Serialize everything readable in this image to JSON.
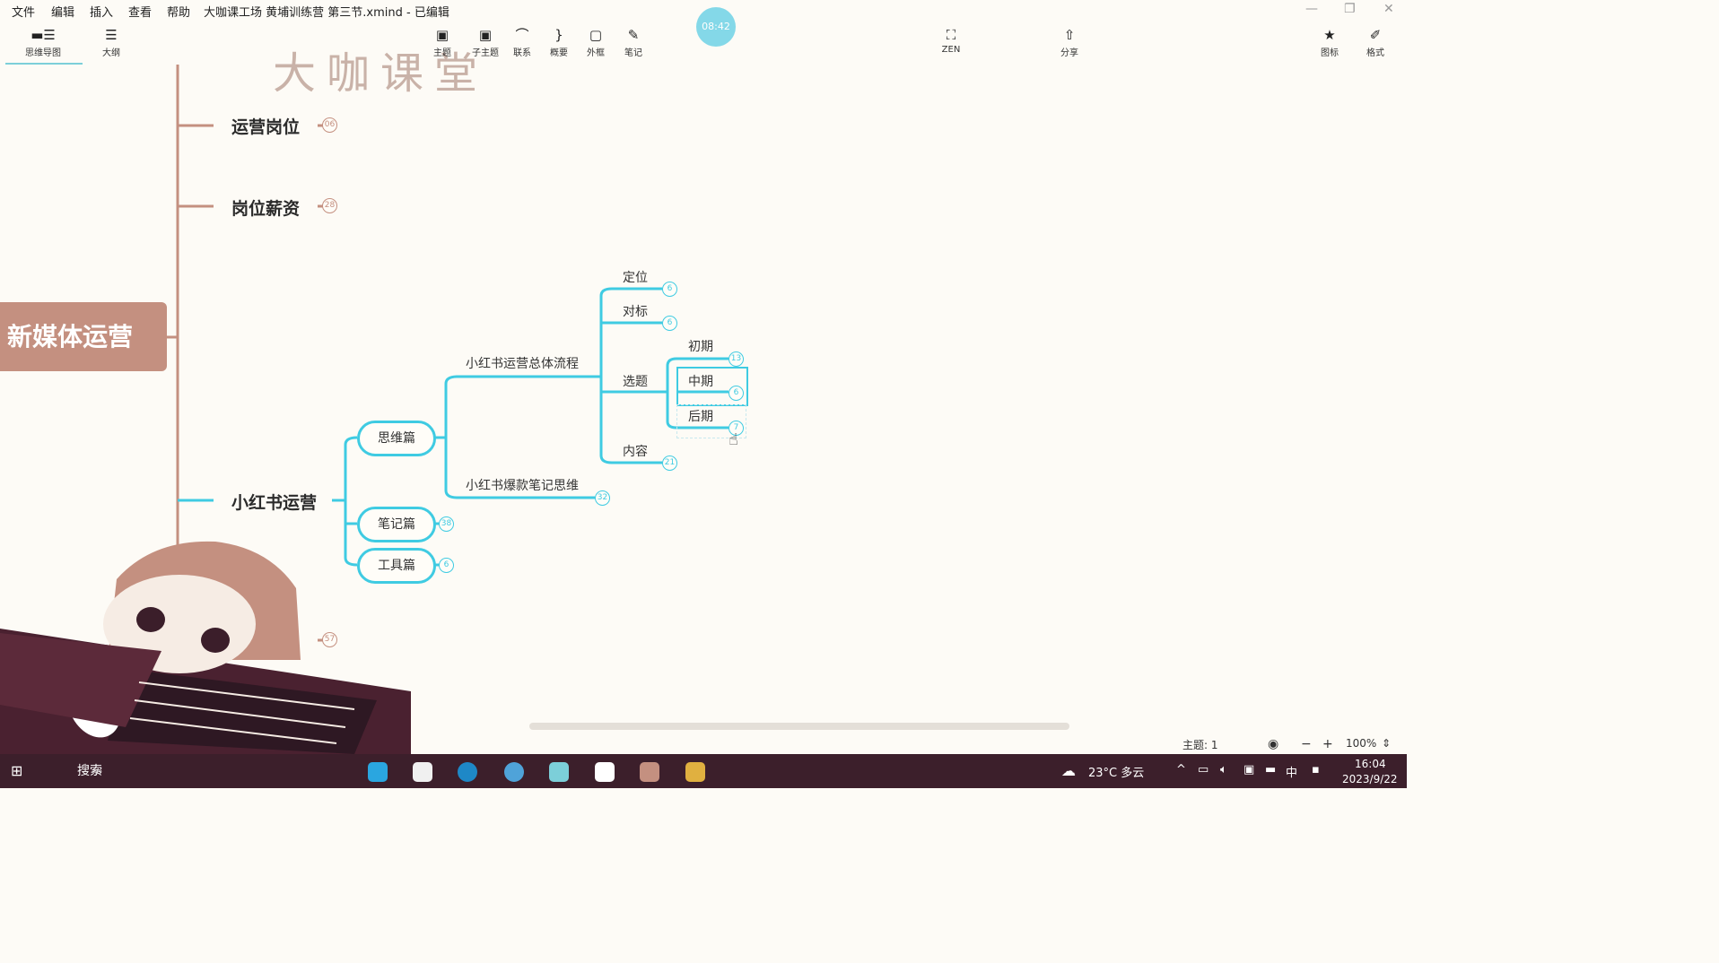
{
  "menu": [
    "文件",
    "编辑",
    "插入",
    "查看",
    "帮助"
  ],
  "title": "大咖课工场 黄埔训练营 第三节.xmind - 已编辑",
  "toolbar": {
    "mindmap": "思维导图",
    "outline": "大纲",
    "topic": "主题",
    "subtopic": "子主题",
    "relation": "联系",
    "summary": "概要",
    "boundary": "外框",
    "note": "笔记",
    "zen": "ZEN",
    "share": "分享",
    "icon": "图标",
    "format": "格式"
  },
  "timer": "08:42",
  "watermark": "大咖课堂",
  "map": {
    "root": "新媒体运营",
    "b1": {
      "label": "运营岗位",
      "count": "06"
    },
    "b2": {
      "label": "岗位薪资",
      "count": "28"
    },
    "b3": {
      "label": "小红书运营"
    },
    "b4": {
      "count": "57"
    },
    "siwei": "思维篇",
    "biji": {
      "label": "笔记篇",
      "count": "38"
    },
    "gongju": {
      "label": "工具篇",
      "count": "6"
    },
    "flow": "小红书运营总体流程",
    "baokuan": {
      "label": "小红书爆款笔记思维",
      "count": "32"
    },
    "dingwei": {
      "label": "定位",
      "count": "6"
    },
    "duibiao": {
      "label": "对标",
      "count": "6"
    },
    "xuanti": "选题",
    "neirong": {
      "label": "内容",
      "count": "21"
    },
    "chuqi": {
      "label": "初期",
      "count": "13"
    },
    "zhongqi": {
      "label": "中期",
      "count": "6"
    },
    "houqi": {
      "label": "后期",
      "count": "7"
    }
  },
  "statusbar": {
    "topics": "主题: 1",
    "zoom": "100%",
    "minus": "−",
    "plus": "+"
  },
  "taskbar": {
    "search": "搜索",
    "weather": "23°C 多云",
    "ime": "中",
    "time": "16:04",
    "date": "2023/9/22"
  },
  "colors": {
    "branch": "#3fcbe2",
    "root": "#c49080",
    "taskbar": "#3c1f2b"
  }
}
